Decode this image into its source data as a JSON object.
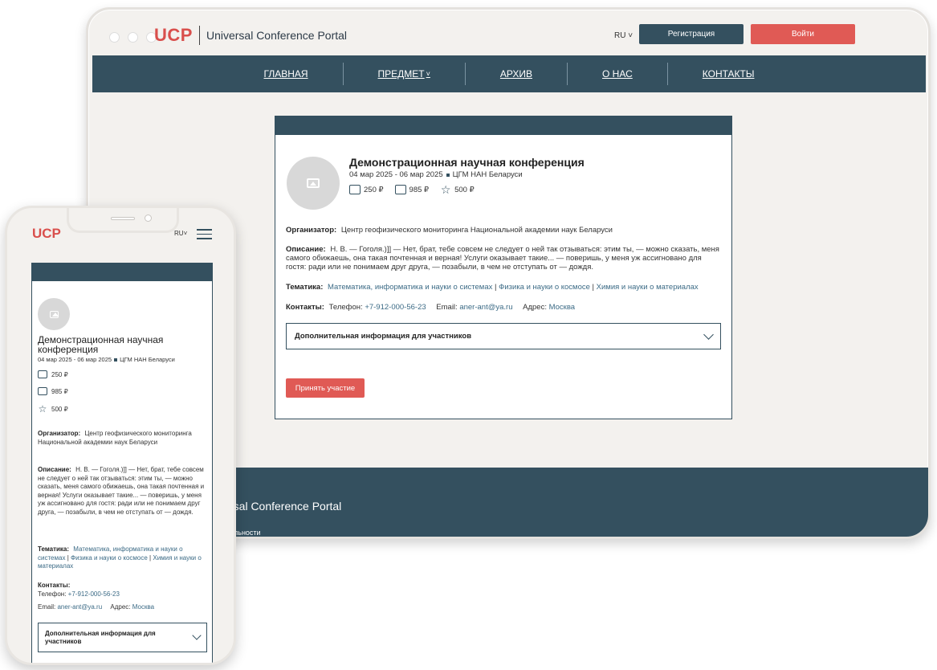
{
  "brand": {
    "logo": "UCP",
    "name": "Universal Conference Portal"
  },
  "colors": {
    "primary": "#34505f",
    "accent": "#e05a55",
    "link": "#3c6b86",
    "background": "#f3f1ee"
  },
  "header": {
    "lang": "RU",
    "register_label": "Регистрация",
    "login_label": "Войти"
  },
  "nav": {
    "items": [
      "ГЛАВНАЯ",
      "ПРЕДМЕТ",
      "АРХИВ",
      "О НАС",
      "КОНТАКТЫ"
    ]
  },
  "conference": {
    "title": "Демонстрационная научная конференция",
    "mobile_title": "Демонстрационная научная конференция",
    "dates": "04 мар 2025 - 06 мар 2025",
    "venue": "ЦГМ НАН Беларуси",
    "prices": [
      {
        "icon": "graduation-cap-icon",
        "value": "250 ₽"
      },
      {
        "icon": "presentation-board-icon",
        "value": "985 ₽"
      },
      {
        "icon": "star-icon",
        "value": "500 ₽"
      }
    ],
    "organizer_label": "Организатор:",
    "organizer": "Центр геофизического мониторинга Национальной академии наук Беларуси",
    "description_label": "Описание:",
    "description": "Н. В. — Гоголя.)]] — Нет, брат, тебе совсем не следует о ней так отзываться: этим ты, — можно сказать, меня самого обижаешь, она такая почтенная и верная! Услуги оказывает такие... — поверишь, у меня уж ассигновано для гостя: ради или не понимаем друг друга, — позабыли, в чем не отступать от — дождя.",
    "topics_label": "Тематика:",
    "topics": [
      "Математика, информатика и науки о системах",
      "Физика и науки о космосе",
      "Химия и науки о материалах"
    ],
    "topics_sep": "|",
    "contacts_label": "Контакты:",
    "phone_label": "Телефон:",
    "phone": "+7-912-000-56-23",
    "email_label": "Email:",
    "email": "aner-ant@ya.ru",
    "address_label": "Адрес:",
    "address": "Москва",
    "accordion_label": "Дополнительная информация для участников",
    "join_label": "Принять участие"
  },
  "footer": {
    "name": "rsal Conference Portal",
    "sub": "альности"
  }
}
